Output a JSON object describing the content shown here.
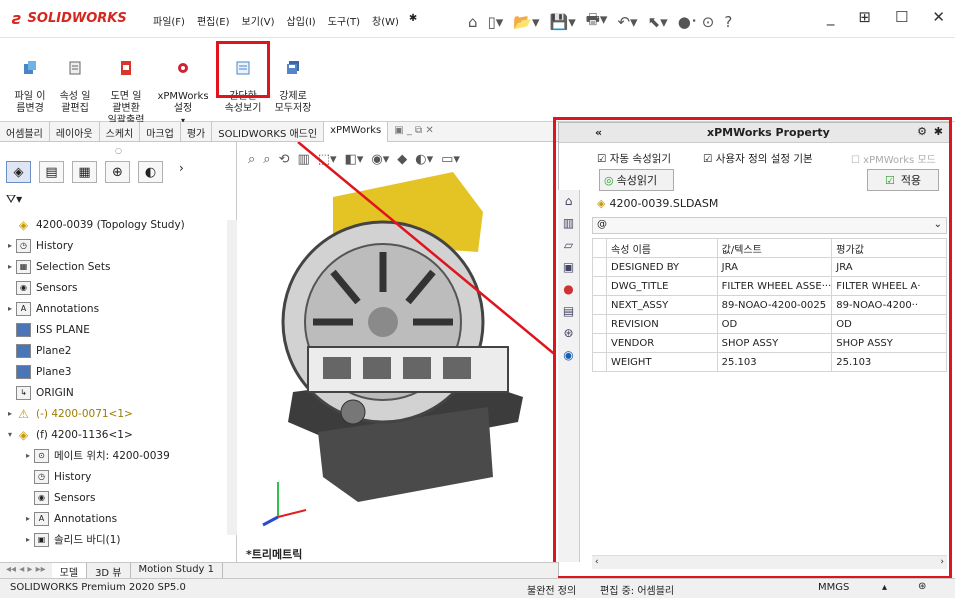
{
  "app": {
    "brand": "SOLIDWORKS"
  },
  "menu": [
    "파일(F)",
    "편집(E)",
    "보기(V)",
    "삽입(I)",
    "도구(T)",
    "창(W)"
  ],
  "ribbon": {
    "b1": "파일 이\n름변경",
    "b2": "속성 일\n괄편집",
    "b3": "도면 일\n괄변환\n일괄출력",
    "b4": "xPMWorks\n설정",
    "b5": "간단한\n속성보기",
    "b6": "강제로\n모두저장"
  },
  "tabs": [
    "어셈블리",
    "레이아웃",
    "스케치",
    "마크업",
    "평가",
    "SOLIDWORKS 애드인",
    "xPMWorks"
  ],
  "tree": [
    {
      "label": "4200-0039  (Topology Study)",
      "icon": "assembly-icon",
      "arrow": "",
      "color": "#222"
    },
    {
      "label": "History",
      "icon": "history-icon",
      "arrow": "▸",
      "color": "#222"
    },
    {
      "label": "Selection Sets",
      "icon": "selection-sets-icon",
      "arrow": "▸",
      "color": "#222"
    },
    {
      "label": "Sensors",
      "icon": "sensor-icon",
      "arrow": "",
      "color": "#222"
    },
    {
      "label": "Annotations",
      "icon": "annotations-icon",
      "arrow": "▸",
      "color": "#222"
    },
    {
      "label": "ISS PLANE",
      "icon": "plane-icon",
      "arrow": "",
      "color": "#222"
    },
    {
      "label": "Plane2",
      "icon": "plane-icon",
      "arrow": "",
      "color": "#222"
    },
    {
      "label": "Plane3",
      "icon": "plane-icon",
      "arrow": "",
      "color": "#222"
    },
    {
      "label": "ORIGIN",
      "icon": "origin-icon",
      "arrow": "",
      "color": "#222"
    },
    {
      "label": "(-) 4200-0071<1>",
      "icon": "warning-icon",
      "arrow": "▸",
      "color": "#9a7d00"
    },
    {
      "label": "(f) 4200-1136<1>",
      "icon": "subassembly-icon",
      "arrow": "▾",
      "color": "#222"
    },
    {
      "label": "메이트 위치: 4200-0039",
      "icon": "mate-icon",
      "arrow": "▸",
      "color": "#222"
    },
    {
      "label": "History",
      "icon": "history-icon",
      "arrow": "",
      "color": "#222"
    },
    {
      "label": "Sensors",
      "icon": "sensor-icon",
      "arrow": "",
      "color": "#222"
    },
    {
      "label": "Annotations",
      "icon": "annotations-icon",
      "arrow": "▸",
      "color": "#222"
    },
    {
      "label": "솔리드 바디(1)",
      "icon": "solid-body-icon",
      "arrow": "▸",
      "color": "#222"
    }
  ],
  "viewport": {
    "label": "*트리메트릭"
  },
  "bottom_tabs": [
    "모델",
    "3D 뷰",
    "Motion Study 1"
  ],
  "panel": {
    "title": "xPMWorks Property",
    "chk1": "자동 속성읽기",
    "chk2": "사용자 정의 설정 기본",
    "chk3": "xPMWorks 모드",
    "read_btn": "속성읽기",
    "apply_btn": "적용",
    "filename": "4200-0039.SLDASM",
    "config": "@",
    "columns": [
      "속성 이름",
      "값/텍스트",
      "평가값"
    ],
    "rows": [
      [
        "DESIGNED BY",
        "JRA",
        "JRA"
      ],
      [
        "DWG_TITLE",
        "FILTER WHEEL ASSE···",
        "FILTER WHEEL A·"
      ],
      [
        "NEXT_ASSY",
        "89-NOAO-4200-0025",
        "89-NOAO-4200··"
      ],
      [
        "REVISION",
        "OD",
        "OD"
      ],
      [
        "VENDOR",
        "SHOP ASSY",
        "SHOP ASSY"
      ],
      [
        "WEIGHT",
        "25.103",
        "25.103"
      ]
    ]
  },
  "status": {
    "product": "SOLIDWORKS Premium 2020 SP5.0",
    "def": "불완전 정의",
    "edit": "편집 중: 어셈블리",
    "units": "MMGS"
  },
  "colors": {
    "highlight": "#e0141d",
    "brand": "#d4271f"
  }
}
